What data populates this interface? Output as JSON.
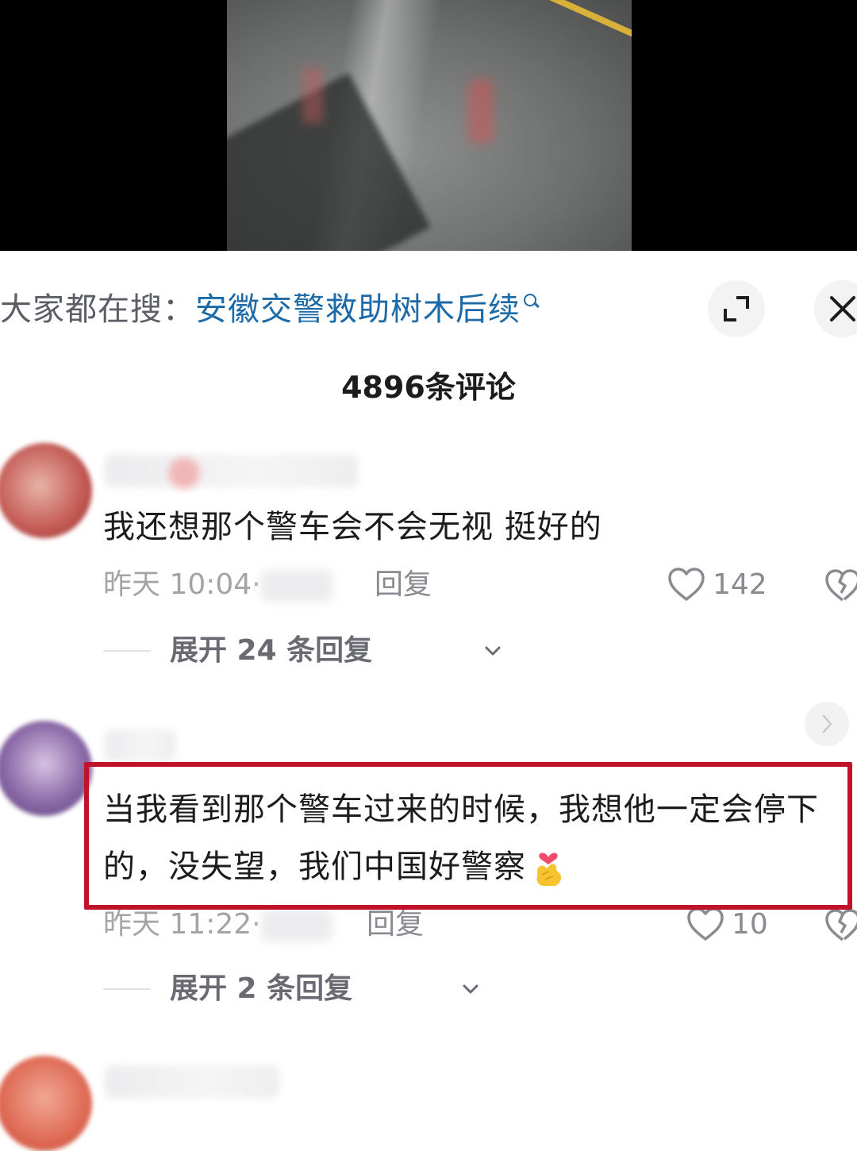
{
  "search_suggestion": {
    "prefix": "大家都在搜：",
    "query": "安徽交警救助树木后续",
    "link_color": "#1d6aa8"
  },
  "comments_header": {
    "title": "4896条评论"
  },
  "comments": [
    {
      "text": "我还想那个警车会不会无视 挺好的",
      "time": "昨天 10:04·",
      "reply_label": "回复",
      "likes": "142",
      "expand_label": "展开 24 条回复"
    },
    {
      "text": "当我看到那个警车过来的时候，我想他一定会停下的，没失望，我们中国好警察",
      "emoji": "heart-hands-icon",
      "time": "昨天 11:22·",
      "reply_label": "回复",
      "likes": "10",
      "expand_label": "展开 2 条回复",
      "highlight_color": "#c0122a"
    }
  ]
}
